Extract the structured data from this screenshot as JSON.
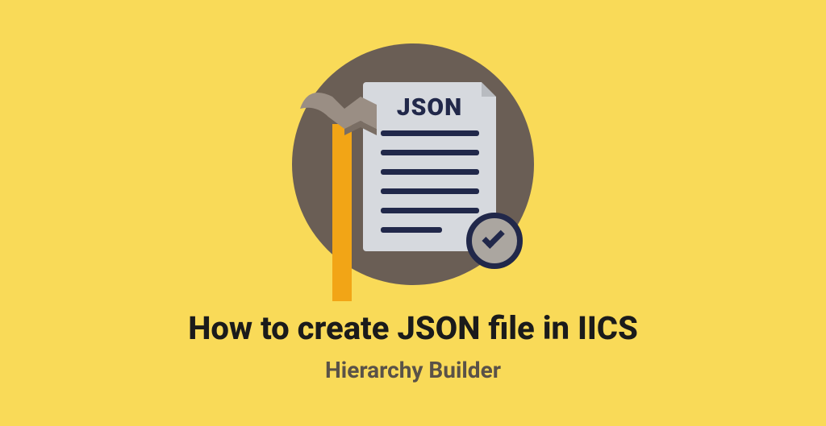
{
  "illustration": {
    "document_label": "JSON"
  },
  "title": "How to create JSON file in IICS",
  "subtitle": "Hierarchy Builder"
}
